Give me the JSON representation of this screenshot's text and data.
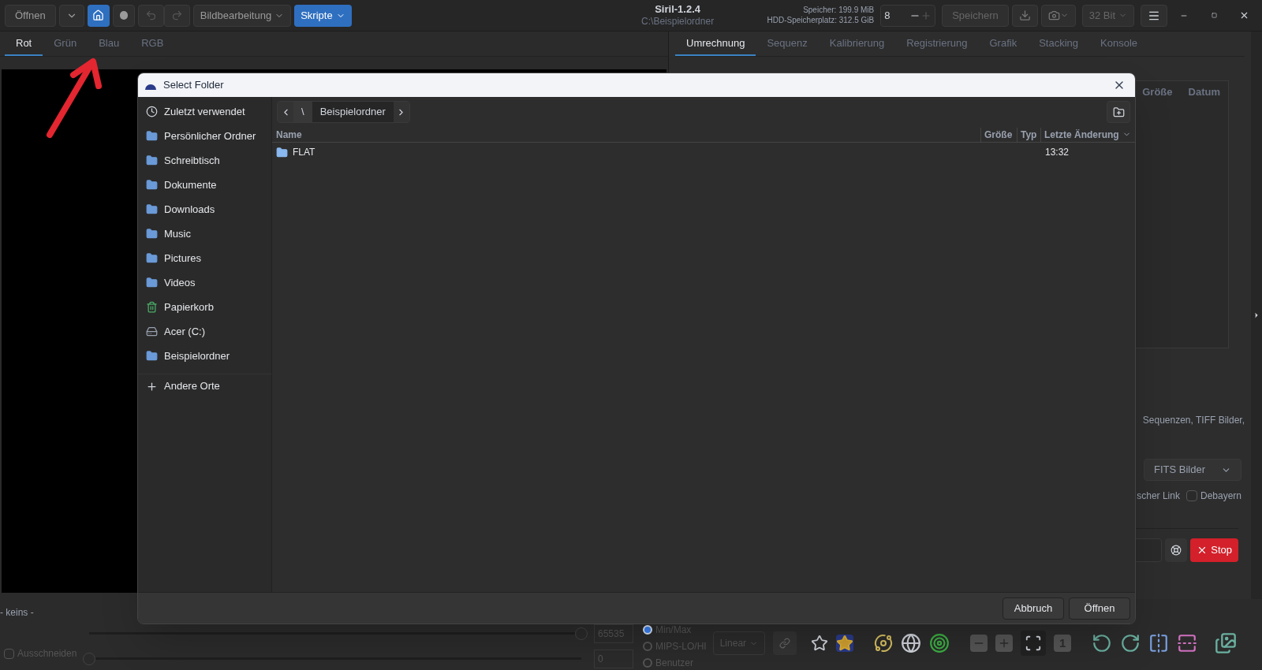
{
  "toolbar": {
    "open": "Öffnen",
    "home_selected": true,
    "image_processing": "Bildbearbeitung",
    "scripts": "Skripte",
    "title": "Siril-1.2.4",
    "path": "C:\\Beispielordner",
    "memory": "Speicher: 199.9 MiB",
    "disk": "HDD-Speicherplatz: 312.5 GiB",
    "threads": "8",
    "save": "Speichern",
    "bit_depth": "32 Bit"
  },
  "channel_tabs": [
    {
      "label": "Rot",
      "selected": true
    },
    {
      "label": "Grün",
      "selected": false
    },
    {
      "label": "Blau",
      "selected": false
    },
    {
      "label": "RGB",
      "selected": false
    }
  ],
  "tool_tabs": [
    {
      "label": "Umrechnung",
      "selected": true
    },
    {
      "label": "Sequenz",
      "selected": false
    },
    {
      "label": "Kalibrierung",
      "selected": false
    },
    {
      "label": "Registrierung",
      "selected": false
    },
    {
      "label": "Grafik",
      "selected": false
    },
    {
      "label": "Stacking",
      "selected": false
    },
    {
      "label": "Konsole",
      "selected": false
    }
  ],
  "right_panel": {
    "columns": [
      "Größe",
      "Datum"
    ],
    "description": "Sequenzen, TIFF Bilder,",
    "output_format": "FITS Bilder",
    "link_label": "scher Link",
    "debayer": {
      "label": "Debayern",
      "checked": false
    },
    "stop": "Stop"
  },
  "bottom": {
    "selection": "- keins -",
    "crop": {
      "label": "Ausschneiden",
      "checked": false
    },
    "sliders": [
      {
        "level": 1,
        "value": "65535"
      },
      {
        "level": 0,
        "value": "0"
      }
    ],
    "scale_modes": [
      {
        "label": "Min/Max",
        "selected": true
      },
      {
        "label": "MIPS-LO/HI",
        "selected": false
      },
      {
        "label": "Benutzer",
        "selected": false
      }
    ],
    "stretch": "Linear",
    "zoom_label": "1"
  },
  "dialog": {
    "title": "Select Folder",
    "places": [
      {
        "label": "Zuletzt verwendet",
        "kind": "recent"
      },
      {
        "label": "Persönlicher Ordner",
        "kind": "folder"
      },
      {
        "label": "Schreibtisch",
        "kind": "folder"
      },
      {
        "label": "Dokumente",
        "kind": "folder"
      },
      {
        "label": "Downloads",
        "kind": "folder"
      },
      {
        "label": "Music",
        "kind": "folder"
      },
      {
        "label": "Pictures",
        "kind": "folder"
      },
      {
        "label": "Videos",
        "kind": "folder"
      },
      {
        "label": "Papierkorb",
        "kind": "trash"
      },
      {
        "label": "Acer (C:)",
        "kind": "drive"
      },
      {
        "label": "Beispielordner",
        "kind": "folder"
      },
      {
        "label": "Andere Orte",
        "kind": "add"
      }
    ],
    "breadcrumb": [
      {
        "label": "\\",
        "selected": false
      },
      {
        "label": "Beispielordner",
        "selected": true
      }
    ],
    "columns": [
      "Name",
      "Größe",
      "Typ",
      "Letzte Änderung"
    ],
    "rows": [
      {
        "name": "FLAT",
        "modified": "13:32"
      }
    ],
    "buttons": [
      "Abbruch",
      "Öffnen"
    ]
  }
}
